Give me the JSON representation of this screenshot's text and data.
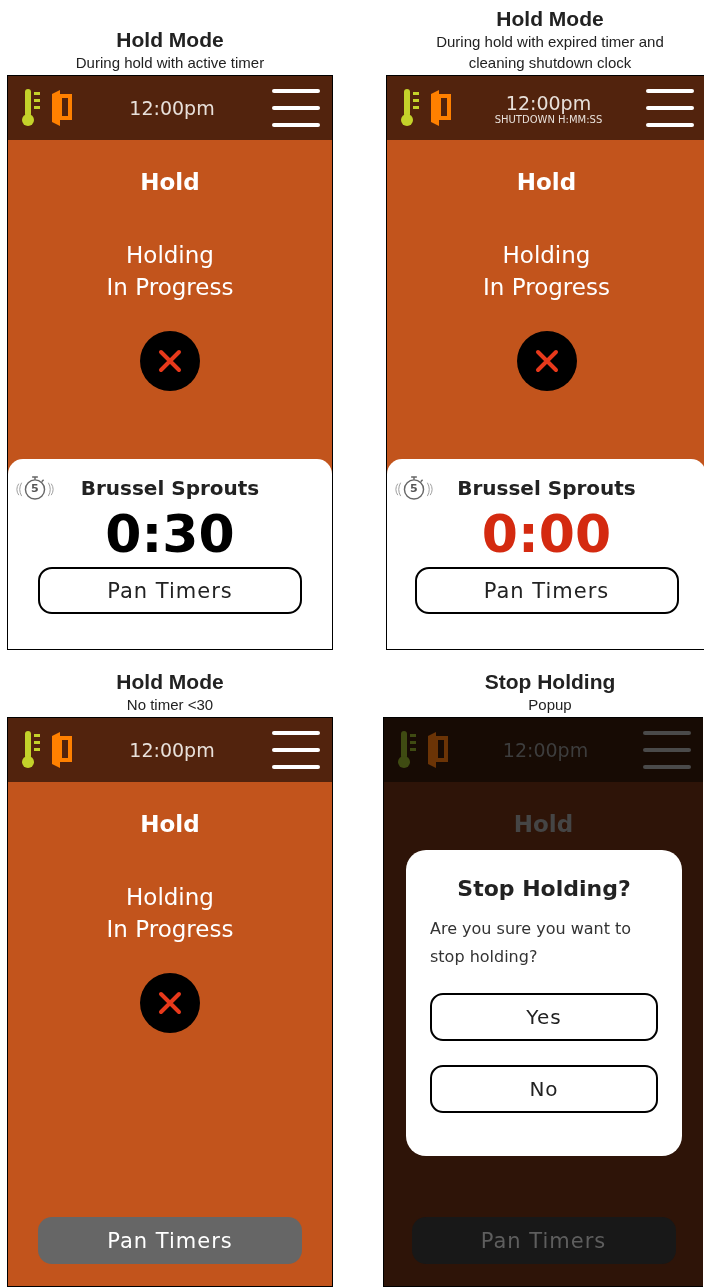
{
  "panels": [
    {
      "caption": {
        "title": "Hold Mode",
        "subtitle": [
          "During hold with active timer"
        ]
      },
      "dimmed": false,
      "screen": {
        "time": "12:00pm",
        "mode_title": "Hold",
        "status": [
          "Holding",
          "In Progress"
        ],
        "timer": {
          "count": "5",
          "name": "Brussel Sprouts",
          "remaining": "0:30",
          "expired": false
        },
        "pan_timers": "Pan Timers"
      }
    },
    {
      "caption": {
        "title": "Hold Mode",
        "subtitle": [
          "During hold with expired timer and",
          "cleaning shutdown clock"
        ]
      },
      "dimmed": false,
      "screen": {
        "time": "12:00pm",
        "shutdown": "SHUTDOWN H:MM:SS",
        "mode_title": "Hold",
        "status": [
          "Holding",
          "In Progress"
        ],
        "timer": {
          "count": "5",
          "name": "Brussel Sprouts",
          "remaining": "0:00",
          "expired": true
        },
        "pan_timers": "Pan Timers"
      }
    },
    {
      "caption": {
        "title": "Hold Mode",
        "subtitle": [
          "No timer <30"
        ]
      },
      "dimmed": false,
      "screen": {
        "time": "12:00pm",
        "mode_title": "Hold",
        "status": [
          "Holding",
          "In Progress"
        ],
        "pan_timers": "Pan Timers"
      }
    },
    {
      "caption": {
        "title": "Stop Holding",
        "subtitle": [
          "Popup"
        ]
      },
      "dimmed": true,
      "screen": {
        "time": "12:00pm",
        "mode_title": "Hold",
        "pan_timers": "Pan Timers"
      },
      "popup": {
        "title": "Stop Holding?",
        "message": "Are you sure you want to stop holding?",
        "buttons": [
          "Yes",
          "No"
        ]
      }
    }
  ]
}
